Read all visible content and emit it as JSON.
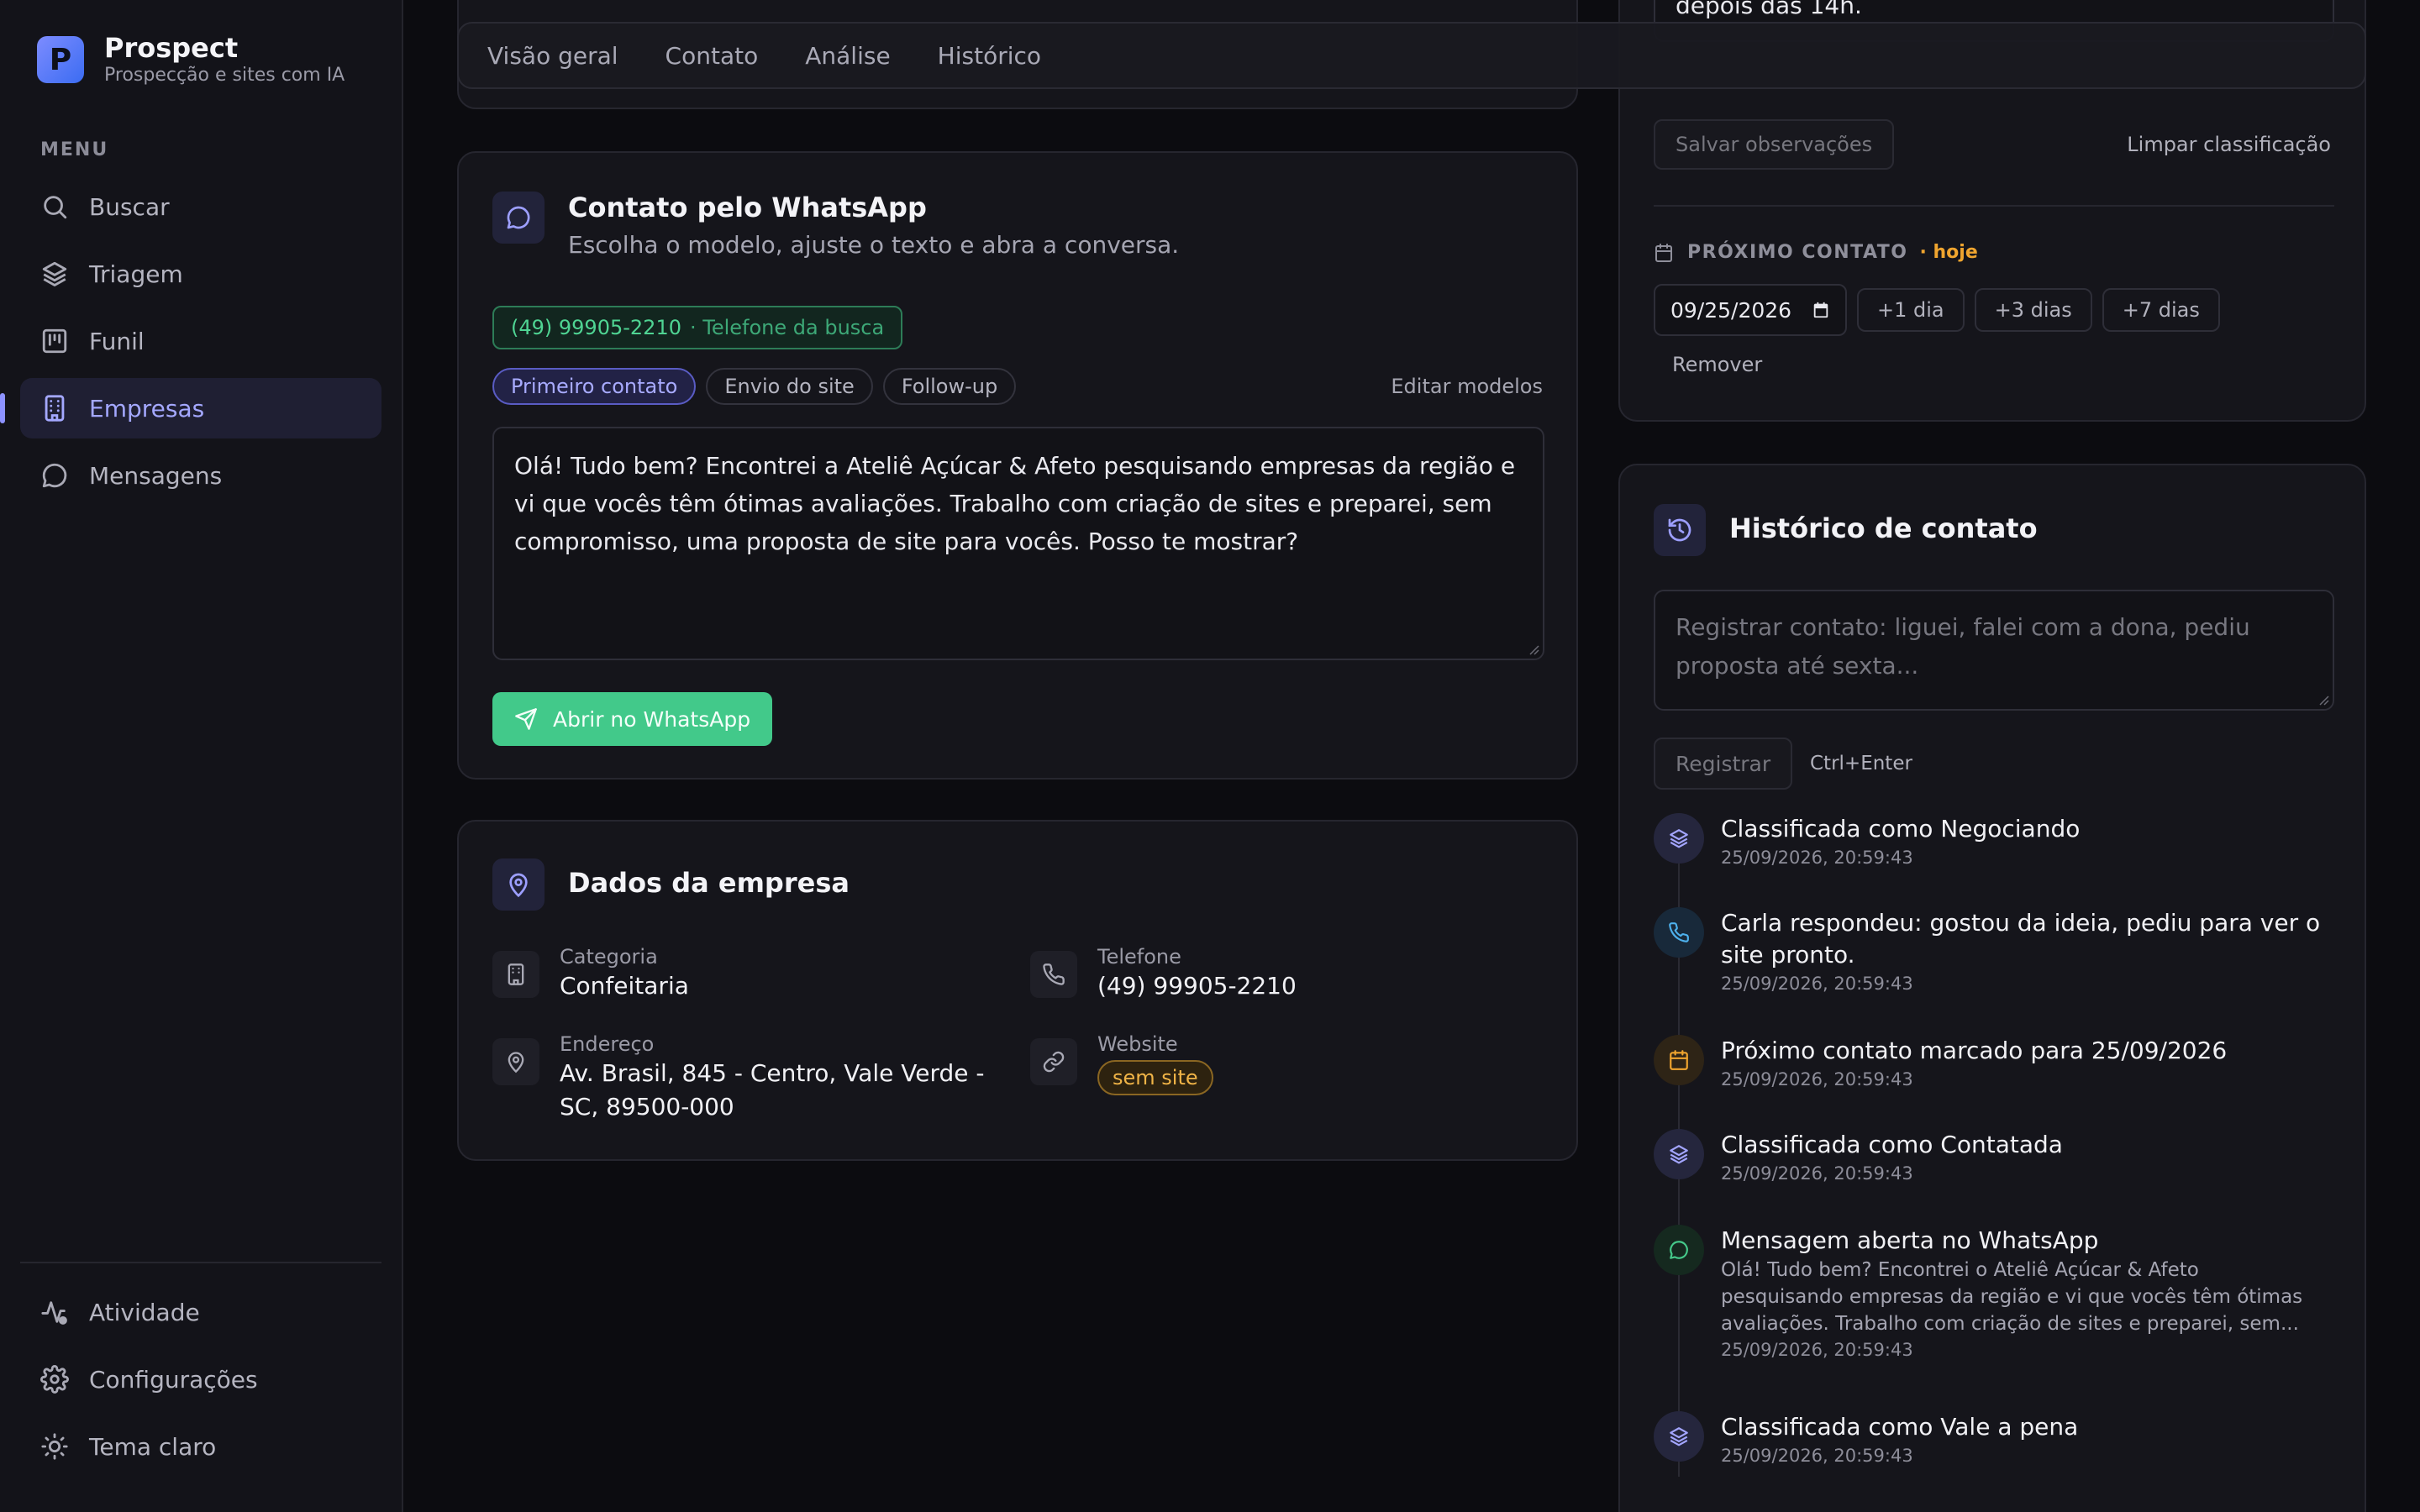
{
  "brand": {
    "initial": "P",
    "name": "Prospect",
    "tagline": "Prospecção e sites com IA"
  },
  "sidebar": {
    "menu_heading": "MENU",
    "items": [
      {
        "label": "Buscar",
        "icon": "search-icon"
      },
      {
        "label": "Triagem",
        "icon": "layers-icon"
      },
      {
        "label": "Funil",
        "icon": "kanban-icon"
      },
      {
        "label": "Empresas",
        "icon": "building-icon",
        "active": true
      },
      {
        "label": "Mensagens",
        "icon": "chat-icon"
      }
    ],
    "bottom_items": [
      {
        "label": "Atividade",
        "icon": "activity-icon"
      },
      {
        "label": "Configurações",
        "icon": "gear-icon"
      },
      {
        "label": "Tema claro",
        "icon": "sun-icon"
      }
    ]
  },
  "tabs": [
    "Visão geral",
    "Contato",
    "Análise",
    "Histórico"
  ],
  "whatsapp": {
    "title": "Contato pelo WhatsApp",
    "subtitle": "Escolha o modelo, ajuste o texto e abra a conversa.",
    "phone": "(49) 99905-2210",
    "phone_source": "· Telefone da busca",
    "templates": [
      "Primeiro contato",
      "Envio do site",
      "Follow-up"
    ],
    "active_template": "Primeiro contato",
    "edit_models": "Editar modelos",
    "message": "Olá! Tudo bem? Encontrei a Ateliê Açúcar & Afeto pesquisando empresas da região e vi que vocês têm ótimas avaliações. Trabalho com criação de sites e preparei, sem compromisso, uma proposta de site para vocês. Posso te mostrar?",
    "open_button": "Abrir no WhatsApp"
  },
  "company": {
    "title": "Dados da empresa",
    "category_label": "Categoria",
    "category": "Confeitaria",
    "phone_label": "Telefone",
    "phone": "(49) 99905-2210",
    "address_label": "Endereço",
    "address": "Av. Brasil, 845 - Centro, Vale Verde - SC, 89500-000",
    "website_label": "Website",
    "website_status": "sem site"
  },
  "observations": {
    "note_tail": "depois das 14h.",
    "save_button": "Salvar observações",
    "clear_button": "Limpar classificação",
    "next_contact_heading": "PRÓXIMO CONTATO",
    "next_contact_when": "· hoje",
    "date_value": "09/25/2026",
    "quick_buttons": [
      "+1 dia",
      "+3 dias",
      "+7 dias"
    ],
    "remove_button": "Remover"
  },
  "history": {
    "title": "Histórico de contato",
    "placeholder": "Registrar contato: liguei, falei com a dona, pediu proposta até sexta...",
    "register_button": "Registrar",
    "shortcut": "Ctrl+Enter",
    "entries": [
      {
        "icon": "layers-icon",
        "color": "violet",
        "title": "Classificada como Negociando",
        "detail": "",
        "time": "25/09/2026, 20:59:43"
      },
      {
        "icon": "phone-icon",
        "color": "blue",
        "title": "Carla respondeu: gostou da ideia, pediu para ver o site pronto.",
        "detail": "",
        "time": "25/09/2026, 20:59:43"
      },
      {
        "icon": "calendar-icon",
        "color": "amber",
        "title": "Próximo contato marcado para 25/09/2026",
        "detail": "",
        "time": "25/09/2026, 20:59:43"
      },
      {
        "icon": "layers-icon",
        "color": "violet",
        "title": "Classificada como Contatada",
        "detail": "",
        "time": "25/09/2026, 20:59:43"
      },
      {
        "icon": "chat-icon",
        "color": "green",
        "title": "Mensagem aberta no WhatsApp",
        "detail": "Olá! Tudo bem? Encontrei o Ateliê Açúcar & Afeto pesquisando empresas da região e vi que vocês têm ótimas avaliações. Trabalho com criação de sites e preparei, sem...",
        "time": "25/09/2026, 20:59:43"
      },
      {
        "icon": "layers-icon",
        "color": "violet",
        "title": "Classificada como Vale a pena",
        "detail": "",
        "time": "25/09/2026, 20:59:43"
      }
    ]
  },
  "colors": {
    "accent": "#8d92ff",
    "whatsapp_green": "#42c98a",
    "warning": "#f0a52f",
    "background": "#0c0c10",
    "sidebar": "#131319",
    "card": "#15151b"
  }
}
